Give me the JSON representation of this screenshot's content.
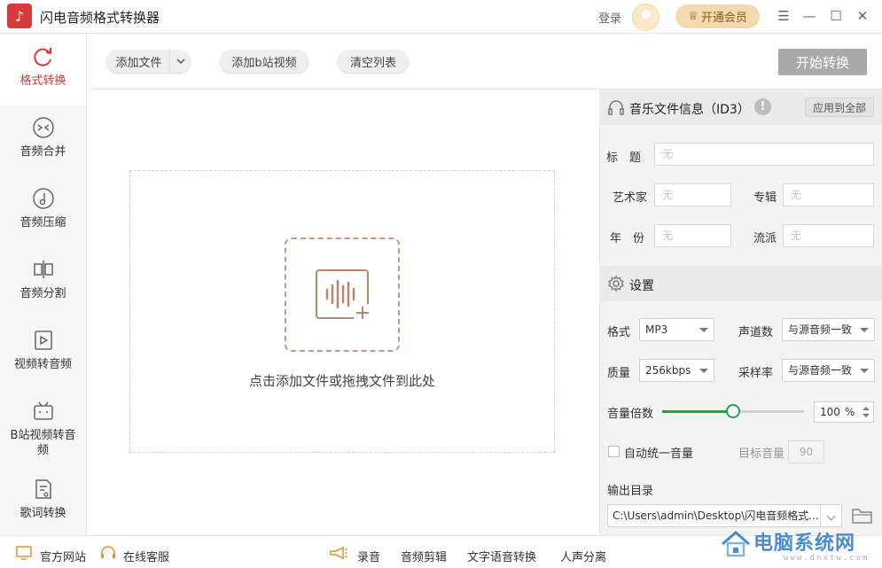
{
  "app": {
    "title": "闪电音频格式转换器",
    "login": "登录",
    "vip_label": "开通会员"
  },
  "sidebar": {
    "items": [
      {
        "label": "格式转换",
        "icon": "refresh-icon",
        "active": true
      },
      {
        "label": "音频合并",
        "icon": "merge-icon"
      },
      {
        "label": "音频压缩",
        "icon": "compress-icon"
      },
      {
        "label": "音频分割",
        "icon": "split-icon"
      },
      {
        "label": "视频转音频",
        "icon": "video-icon"
      },
      {
        "label": "B站视频转音频",
        "icon": "bilibili-icon"
      },
      {
        "label": "歌词转换",
        "icon": "lyrics-icon"
      }
    ]
  },
  "toolbar": {
    "add_file": "添加文件",
    "add_bilibili": "添加b站视频",
    "clear_list": "清空列表",
    "start": "开始转换"
  },
  "dropzone": {
    "hint": "点击添加文件或拖拽文件到此处"
  },
  "id3": {
    "title": "音乐文件信息（ID3）",
    "apply_all": "应用到全部",
    "title_label": "标　题",
    "artist_label": "艺术家",
    "album_label": "专辑",
    "year_label": "年　份",
    "genre_label": "流派",
    "placeholder": "无"
  },
  "settings": {
    "title": "设置",
    "format_label": "格式",
    "format_value": "MP3",
    "channels_label": "声道数",
    "channels_value": "与源音频一致",
    "quality_label": "质量",
    "quality_value": "256kbps",
    "samplerate_label": "采样率",
    "samplerate_value": "与源音频一致",
    "volume_label": "音量倍数",
    "volume_value": "100",
    "volume_unit": "%",
    "volume_level": 0.5,
    "auto_volume_label": "自动统一音量",
    "target_volume_label": "目标音量",
    "target_volume_value": "90",
    "output_label": "输出目录",
    "output_path": "C:\\Users\\admin\\Desktop\\闪电音频格式..."
  },
  "bottombar": {
    "website": "官方网站",
    "support": "在线客服",
    "record": "录音",
    "audio_edit": "音频剪辑",
    "tts": "文字语音转换",
    "vocal_separation": "人声分离"
  },
  "watermark": {
    "text": "电脑系统网",
    "sub": "www.dnxtw.com"
  },
  "colors": {
    "accent": "#d63a3a",
    "slider": "#22a04a",
    "drop_border": "#c29a85"
  }
}
